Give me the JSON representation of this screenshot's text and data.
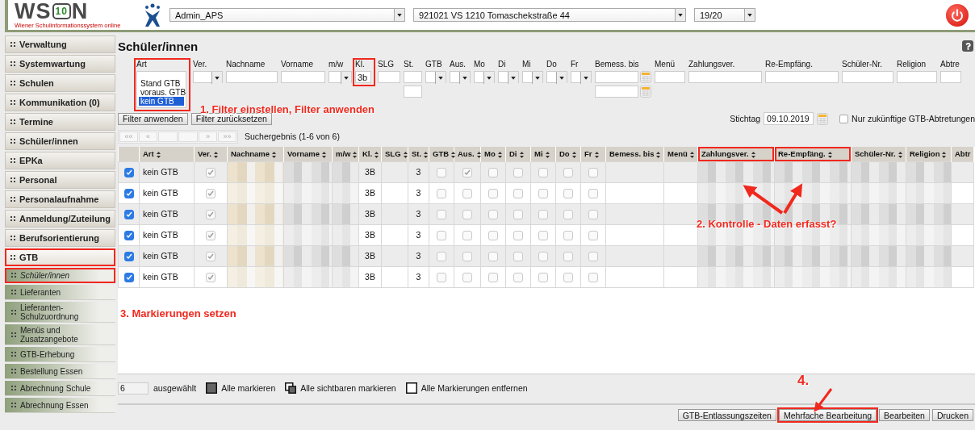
{
  "header": {
    "logo": {
      "left": "WS",
      "badge": "10",
      "right": "N",
      "subtitle": "Wiener Schulinformationssystem online"
    },
    "selects": [
      {
        "value": "Admin_APS"
      },
      {
        "value": "921021 VS 1210 Tomaschekstraße 44"
      },
      {
        "value": "19/20"
      }
    ]
  },
  "sidebar": [
    {
      "label": "Verwaltung",
      "selected": false,
      "highlighted": false
    },
    {
      "label": "Systemwartung",
      "selected": false,
      "highlighted": false
    },
    {
      "label": "Schulen",
      "selected": false,
      "highlighted": false
    },
    {
      "label": "Kommunikation (0)",
      "selected": false,
      "highlighted": false
    },
    {
      "label": "Termine",
      "selected": false,
      "highlighted": false
    },
    {
      "label": "Schüler/innen",
      "selected": false,
      "highlighted": false
    },
    {
      "label": "EPKa",
      "selected": false,
      "highlighted": false
    },
    {
      "label": "Personal",
      "selected": false,
      "highlighted": false
    },
    {
      "label": "Personalaufnahme",
      "selected": false,
      "highlighted": false
    },
    {
      "label": "Anmeldung/Zuteilung",
      "selected": false,
      "highlighted": false
    },
    {
      "label": "Berufsorientierung",
      "selected": false,
      "highlighted": false
    },
    {
      "label": "GTB",
      "selected": false,
      "expanded": true,
      "highlighted": true,
      "children": [
        {
          "label": "Schüler/innen",
          "selected": true,
          "highlighted": true
        },
        {
          "label": "Lieferanten",
          "selected": false,
          "highlighted": false
        },
        {
          "label": "Lieferanten-Schulzuordnung",
          "selected": false,
          "highlighted": false
        },
        {
          "label": "Menüs und Zusatzangebote",
          "selected": false,
          "highlighted": false
        },
        {
          "label": "GTB-Erhebung",
          "selected": false,
          "highlighted": false
        },
        {
          "label": "Bestellung Essen",
          "selected": false,
          "highlighted": false
        },
        {
          "label": "Abrechnung Schule",
          "selected": false,
          "highlighted": false
        },
        {
          "label": "Abrechnung Essen",
          "selected": false,
          "highlighted": false
        }
      ]
    }
  ],
  "page_title": "Schüler/innen",
  "filters": [
    {
      "label": "Art",
      "kind": "listbox",
      "highlighted": true,
      "options": [
        {
          "label": "Stand GTB",
          "selected": false
        },
        {
          "label": "voraus. GTB",
          "selected": false
        },
        {
          "label": "kein GTB",
          "selected": true
        }
      ]
    },
    {
      "label": "Ver.",
      "kind": "select",
      "highlighted": false
    },
    {
      "label": "Nachname",
      "kind": "text",
      "highlighted": false
    },
    {
      "label": "Vorname",
      "kind": "text",
      "highlighted": false
    },
    {
      "label": "m/w",
      "kind": "select",
      "highlighted": false
    },
    {
      "label": "Kl.",
      "kind": "text",
      "highlighted": true,
      "value": "3b"
    },
    {
      "label": "SLG",
      "kind": "text",
      "highlighted": false
    },
    {
      "label": "St.",
      "kind": "text-pair",
      "highlighted": false
    },
    {
      "label": "GTB",
      "kind": "select",
      "highlighted": false
    },
    {
      "label": "Aus.",
      "kind": "select",
      "highlighted": false
    },
    {
      "label": "Mo",
      "kind": "select",
      "highlighted": false
    },
    {
      "label": "Di",
      "kind": "select",
      "highlighted": false
    },
    {
      "label": "Mi",
      "kind": "select",
      "highlighted": false
    },
    {
      "label": "Do",
      "kind": "select",
      "highlighted": false
    },
    {
      "label": "Fr",
      "kind": "select",
      "highlighted": false
    },
    {
      "label": "Bemess. bis",
      "kind": "date-pair",
      "highlighted": false
    },
    {
      "label": "Menü",
      "kind": "text",
      "highlighted": false
    },
    {
      "label": "Zahlungsver.",
      "kind": "text",
      "highlighted": false
    },
    {
      "label": "Re-Empfäng.",
      "kind": "text",
      "highlighted": false
    },
    {
      "label": "Schüler-Nr.",
      "kind": "text",
      "highlighted": false
    },
    {
      "label": "Religion",
      "kind": "text",
      "highlighted": false
    },
    {
      "label": "Abtre",
      "kind": "text",
      "highlighted": false
    }
  ],
  "filter_buttons": [
    "Filter anwenden",
    "Filter zurücksetzen"
  ],
  "stichtag": {
    "label": "Stichtag",
    "value": "09.10.2019"
  },
  "future_only": {
    "label": "Nur zukünftige GTB-Abtretungen",
    "checked": false
  },
  "pager": {
    "first": "««",
    "prev": "«",
    "next": "»",
    "last": "»»",
    "disabled": true,
    "result": "Suchergebnis (1-6 von 6)"
  },
  "table": {
    "columns": [
      {
        "kind": "select",
        "sortable": false
      },
      {
        "label": "Art",
        "kind": "text",
        "sortable": true
      },
      {
        "label": "Ver.",
        "kind": "bool",
        "sortable": true
      },
      {
        "label": "Nachname",
        "kind": "blurred",
        "sortable": true
      },
      {
        "label": "Vorname",
        "kind": "blurred",
        "sortable": true
      },
      {
        "label": "m/w",
        "kind": "blurred",
        "sortable": true
      },
      {
        "label": "Kl.",
        "kind": "center",
        "sortable": true
      },
      {
        "label": "SLG",
        "kind": "empty",
        "sortable": true
      },
      {
        "label": "St.",
        "kind": "center",
        "sortable": true
      },
      {
        "label": "GTB",
        "kind": "bool",
        "sortable": true
      },
      {
        "label": "Aus.",
        "kind": "bool",
        "sortable": true
      },
      {
        "label": "Mo",
        "kind": "bool",
        "sortable": true
      },
      {
        "label": "Di",
        "kind": "bool",
        "sortable": true
      },
      {
        "label": "Mi",
        "kind": "bool",
        "sortable": true
      },
      {
        "label": "Do",
        "kind": "bool",
        "sortable": true
      },
      {
        "label": "Fr",
        "kind": "bool",
        "sortable": true
      },
      {
        "label": "Bemess. bis",
        "kind": "empty",
        "sortable": true
      },
      {
        "label": "Menü",
        "kind": "empty",
        "sortable": true
      },
      {
        "label": "Zahlungsver.",
        "kind": "blurred",
        "sortable": true,
        "highlighted": true
      },
      {
        "label": "Re-Empfäng.",
        "kind": "blurred",
        "sortable": true,
        "highlighted": true
      },
      {
        "label": "Schüler-Nr.",
        "kind": "blurred",
        "sortable": true
      },
      {
        "label": "Religion",
        "kind": "blurred",
        "sortable": true
      },
      {
        "label": "Abtr",
        "kind": "empty",
        "sortable": false
      }
    ],
    "rows": [
      {
        "selected": true,
        "art": "kein GTB",
        "ver": true,
        "kl": "3B",
        "st": "3",
        "gtb": false,
        "aus": true,
        "mo": false,
        "di": false,
        "mi": false,
        "do": false,
        "fr": false
      },
      {
        "selected": true,
        "art": "kein GTB",
        "ver": true,
        "kl": "3B",
        "st": "3",
        "gtb": false,
        "aus": false,
        "mo": false,
        "di": false,
        "mi": false,
        "do": false,
        "fr": false
      },
      {
        "selected": true,
        "art": "kein GTB",
        "ver": true,
        "kl": "3B",
        "st": "3",
        "gtb": false,
        "aus": false,
        "mo": false,
        "di": false,
        "mi": false,
        "do": false,
        "fr": false
      },
      {
        "selected": true,
        "art": "kein GTB",
        "ver": true,
        "kl": "3B",
        "st": "3",
        "gtb": false,
        "aus": false,
        "mo": false,
        "di": false,
        "mi": false,
        "do": false,
        "fr": false
      },
      {
        "selected": true,
        "art": "kein GTB",
        "ver": true,
        "kl": "3B",
        "st": "3",
        "gtb": false,
        "aus": false,
        "mo": false,
        "di": false,
        "mi": false,
        "do": false,
        "fr": false
      },
      {
        "selected": true,
        "art": "kein GTB",
        "ver": true,
        "kl": "3B",
        "st": "3",
        "gtb": false,
        "aus": false,
        "mo": false,
        "di": false,
        "mi": false,
        "do": false,
        "fr": false
      }
    ]
  },
  "selection": {
    "count": "6",
    "label": "ausgewählt"
  },
  "mark_buttons": [
    {
      "label": "Alle markieren",
      "kind": "all"
    },
    {
      "label": "Alle sichtbaren markieren",
      "kind": "visible"
    },
    {
      "label": "Alle Markierungen entfernen",
      "kind": "none"
    }
  ],
  "action_buttons": [
    {
      "label": "GTB-Entlassungszeiten",
      "highlighted": false
    },
    {
      "label": "Mehrfache Bearbeitung",
      "highlighted": true
    },
    {
      "label": "Bearbeiten",
      "highlighted": false
    },
    {
      "label": "Drucken",
      "highlighted": false
    }
  ],
  "annotations": [
    {
      "text": "1. Filter einstellen, Filter anwenden"
    },
    {
      "text": "2. Kontrolle - Daten erfasst?"
    },
    {
      "text": "3. Markierungen setzen"
    },
    {
      "text": "4."
    }
  ]
}
